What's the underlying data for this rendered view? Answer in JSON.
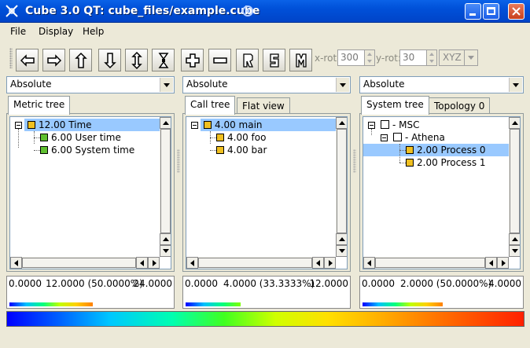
{
  "window": {
    "title": "Cube 3.0 QT: cube_files/example.cube"
  },
  "menubar": {
    "items": [
      "File",
      "Display",
      "Help"
    ]
  },
  "toolbar": {
    "buttons": [
      "arrow-left-icon",
      "arrow-right-icon",
      "arrow-up-icon",
      "arrow-down-icon",
      "arrow-updown-icon",
      "collapse-icon",
      "zoom-in-icon",
      "zoom-out-icon",
      "reset-icon",
      "set-icon",
      "m-icon"
    ],
    "xrot_label": "x-rot:",
    "xrot_value": "300",
    "yrot_label": "y-rot:",
    "yrot_value": "30",
    "axis_value": "XYZ"
  },
  "panels": {
    "metric": {
      "mode": "Absolute",
      "tabs": [
        "Metric tree"
      ],
      "rows": [
        {
          "value": "12.00",
          "label": "Time",
          "color": "#f0c020"
        },
        {
          "value": "6.00",
          "label": "User time",
          "color": "#60c030"
        },
        {
          "value": "6.00",
          "label": "System time",
          "color": "#60c030"
        }
      ],
      "scale_min": "0.0000",
      "scale_sel": "12.0000 (50.0000%)",
      "scale_max": "24.0000"
    },
    "call": {
      "mode": "Absolute",
      "tabs": [
        "Call tree",
        "Flat view"
      ],
      "rows": [
        {
          "value": "4.00",
          "label": "main",
          "color": "#f0c020"
        },
        {
          "value": "4.00",
          "label": "foo",
          "color": "#f0c020"
        },
        {
          "value": "4.00",
          "label": "bar",
          "color": "#f0c020"
        }
      ],
      "scale_min": "0.0000",
      "scale_sel": "4.0000 (33.3333%)",
      "scale_max": "12.0000"
    },
    "system": {
      "mode": "Absolute",
      "tabs": [
        "System tree",
        "Topology 0"
      ],
      "rows": [
        {
          "value": "",
          "label": "- MSC"
        },
        {
          "value": "",
          "label": "- Athena"
        },
        {
          "value": "2.00",
          "label": "Process 0",
          "color": "#f0c020"
        },
        {
          "value": "2.00",
          "label": "Process 1",
          "color": "#f0c020"
        }
      ],
      "scale_min": "0.0000",
      "scale_sel": "2.0000 (50.0000%)",
      "scale_max": "4.0000"
    }
  },
  "colors": {
    "selection": "#99c9ff",
    "titlebar": "#0050d8"
  }
}
